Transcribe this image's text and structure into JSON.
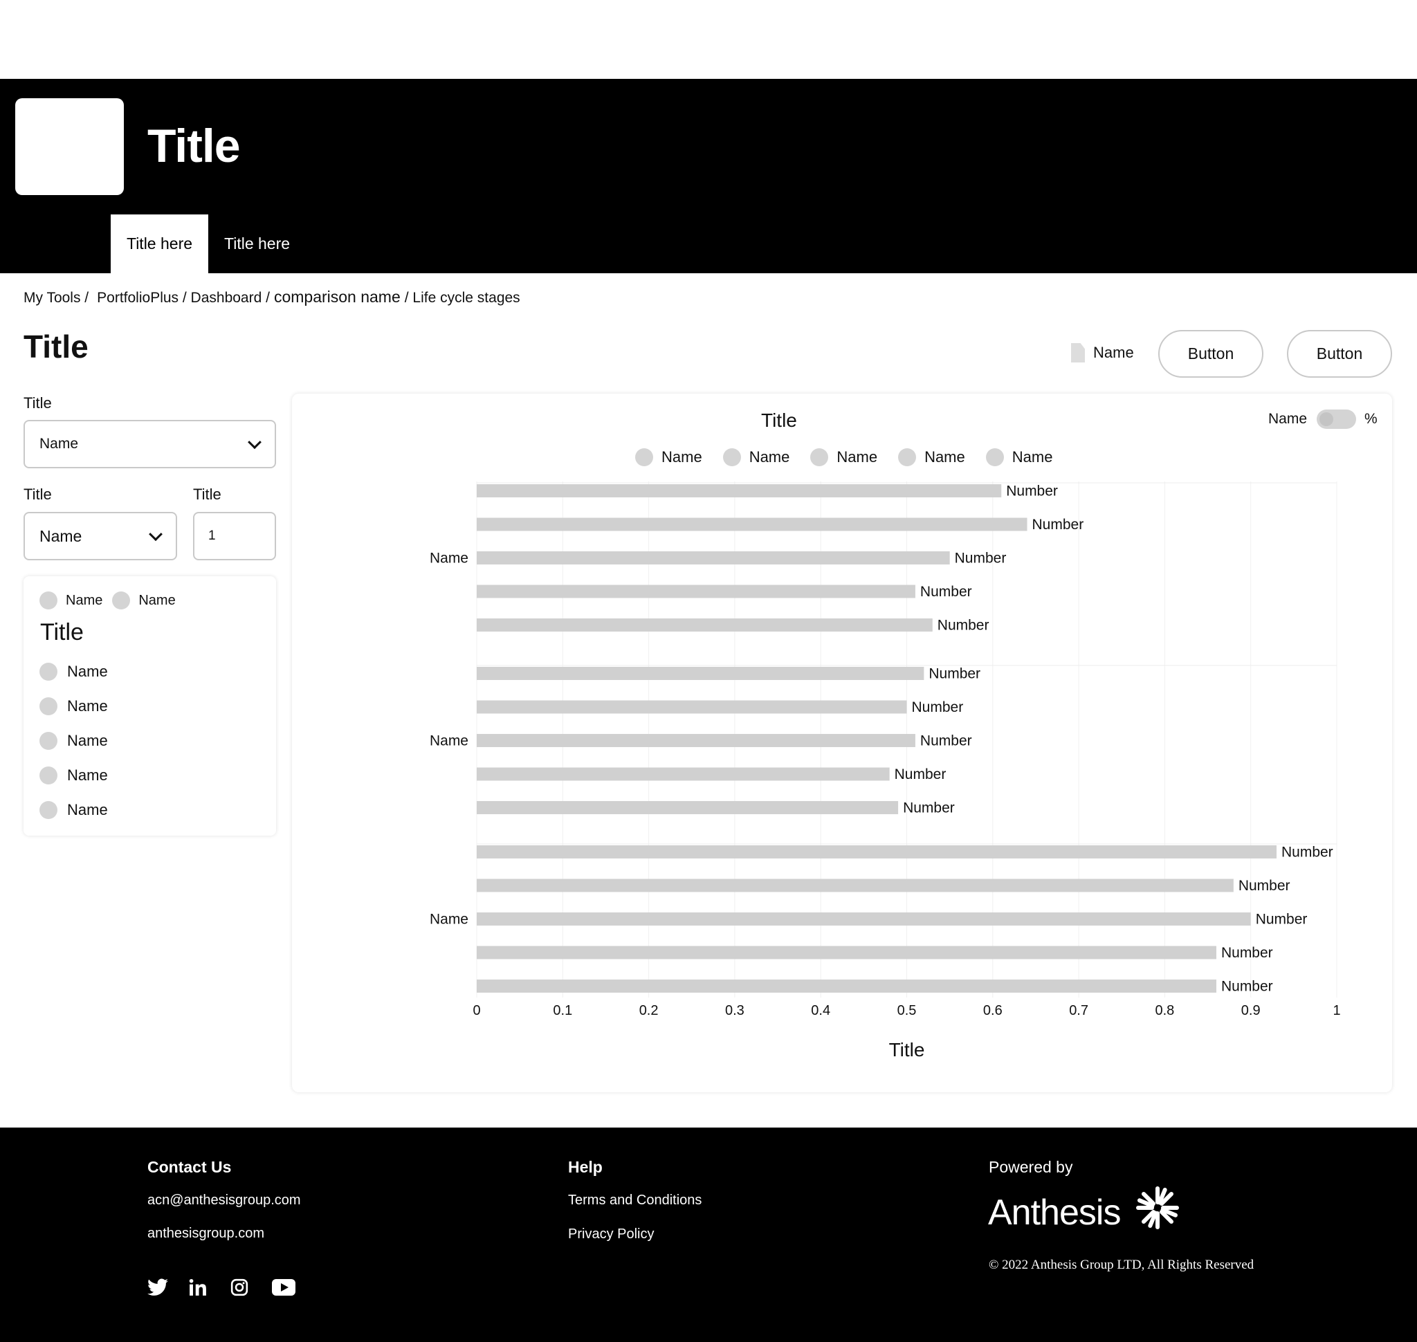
{
  "header": {
    "title": "Title",
    "tabs": [
      {
        "label": "Title here",
        "active": true
      },
      {
        "label": "Title here",
        "active": false
      }
    ]
  },
  "breadcrumb": [
    "My Tools /",
    "PortfolioPlus / Dashboard /",
    "comparison name",
    "/ Life cycle stages"
  ],
  "page": {
    "title": "Title",
    "file_name": "Name",
    "button_1": "Button",
    "button_2": "Button"
  },
  "filters": {
    "label_1": "Title",
    "select_1": "Name",
    "label_2": "Title",
    "select_2": "Name",
    "label_3": "Title",
    "number_value": "1"
  },
  "legend_card": {
    "radio_1": "Name",
    "radio_2": "Name",
    "title": "Title",
    "items": [
      "Name",
      "Name",
      "Name",
      "Name",
      "Name"
    ]
  },
  "chart_toggle": {
    "label": "Name",
    "suffix": "%"
  },
  "chart_data": {
    "type": "bar",
    "orientation": "horizontal",
    "title": "Title",
    "xlabel": "Title",
    "xlim": [
      0,
      1
    ],
    "xticks": [
      0,
      0.1,
      0.2,
      0.3,
      0.4,
      0.5,
      0.6,
      0.7,
      0.8,
      0.9,
      1
    ],
    "legend": [
      "Name",
      "Name",
      "Name",
      "Name",
      "Name"
    ],
    "legend_position": "top-center",
    "grid": true,
    "bar_color": "#d0d0d0",
    "bar_label": "Number",
    "groups": [
      {
        "name": "Name",
        "values": [
          0.61,
          0.64,
          0.55,
          0.51,
          0.53
        ]
      },
      {
        "name": "Name",
        "values": [
          0.52,
          0.5,
          0.51,
          0.48,
          0.49
        ]
      },
      {
        "name": "Name",
        "values": [
          0.93,
          0.88,
          0.9,
          0.86,
          0.86
        ]
      }
    ]
  },
  "footer": {
    "contact_heading": "Contact Us",
    "email": "acn@anthesisgroup.com",
    "website": "anthesisgroup.com",
    "help_heading": "Help",
    "terms": "Terms and Conditions",
    "privacy": "Privacy Policy",
    "powered_by": "Powered by",
    "brand": "Anthesis",
    "copyright": "© 2022 Anthesis Group LTD, All Rights Reserved",
    "social_icons": [
      "twitter-icon",
      "linkedin-icon",
      "instagram-icon",
      "youtube-icon"
    ]
  },
  "colors": {
    "header_bg": "#000000",
    "footer_bg": "#000000",
    "border": "#c9c9c9",
    "dot": "#d4d4d4"
  }
}
